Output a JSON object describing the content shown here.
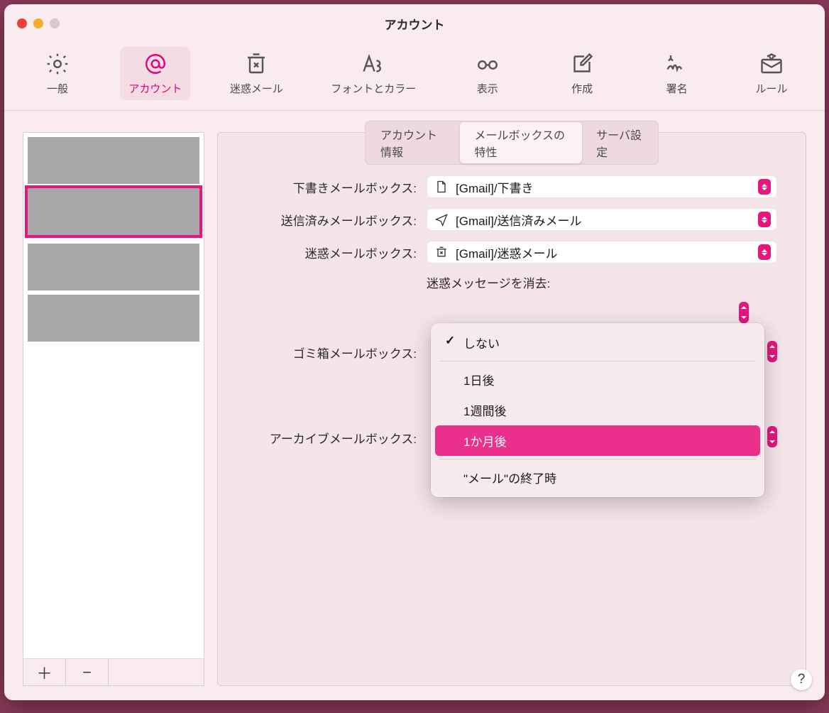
{
  "window_title": "アカウント",
  "toolbar": [
    {
      "id": "general",
      "label": "一般"
    },
    {
      "id": "accounts",
      "label": "アカウント"
    },
    {
      "id": "junk",
      "label": "迷惑メール"
    },
    {
      "id": "fonts",
      "label": "フォントとカラー"
    },
    {
      "id": "viewing",
      "label": "表示"
    },
    {
      "id": "composing",
      "label": "作成"
    },
    {
      "id": "signatures",
      "label": "署名"
    },
    {
      "id": "rules",
      "label": "ルール"
    }
  ],
  "toolbar_active": "accounts",
  "tabs": [
    {
      "id": "info",
      "label": "アカウント情報"
    },
    {
      "id": "behaviors",
      "label": "メールボックスの特性"
    },
    {
      "id": "server",
      "label": "サーバ設定"
    }
  ],
  "tabs_active": "behaviors",
  "sidebar": {
    "add_label": "＋",
    "remove_label": "−",
    "items": [
      {
        "selected": false
      },
      {
        "selected": true
      },
      {
        "selected": false
      },
      {
        "selected": false
      }
    ]
  },
  "form": {
    "drafts_label": "下書きメールボックス:",
    "drafts_value": "[Gmail]/下書き",
    "sent_label": "送信済みメールボックス:",
    "sent_value": "[Gmail]/送信済みメール",
    "junk_label": "迷惑メールボックス:",
    "junk_value": "[Gmail]/迷惑メール",
    "junk_erase_label": "迷惑メッセージを消去:",
    "trash_label": "ゴミ箱メールボックス:",
    "archive_label": "アーカイブメールボックス:"
  },
  "menu": {
    "items": [
      {
        "label": "しない",
        "checked": true
      },
      {
        "label": "1日後"
      },
      {
        "label": "1週間後"
      },
      {
        "label": "1か月後",
        "hover": true
      },
      {
        "label": "\"メール\"の終了時"
      }
    ]
  },
  "help_label": "?"
}
